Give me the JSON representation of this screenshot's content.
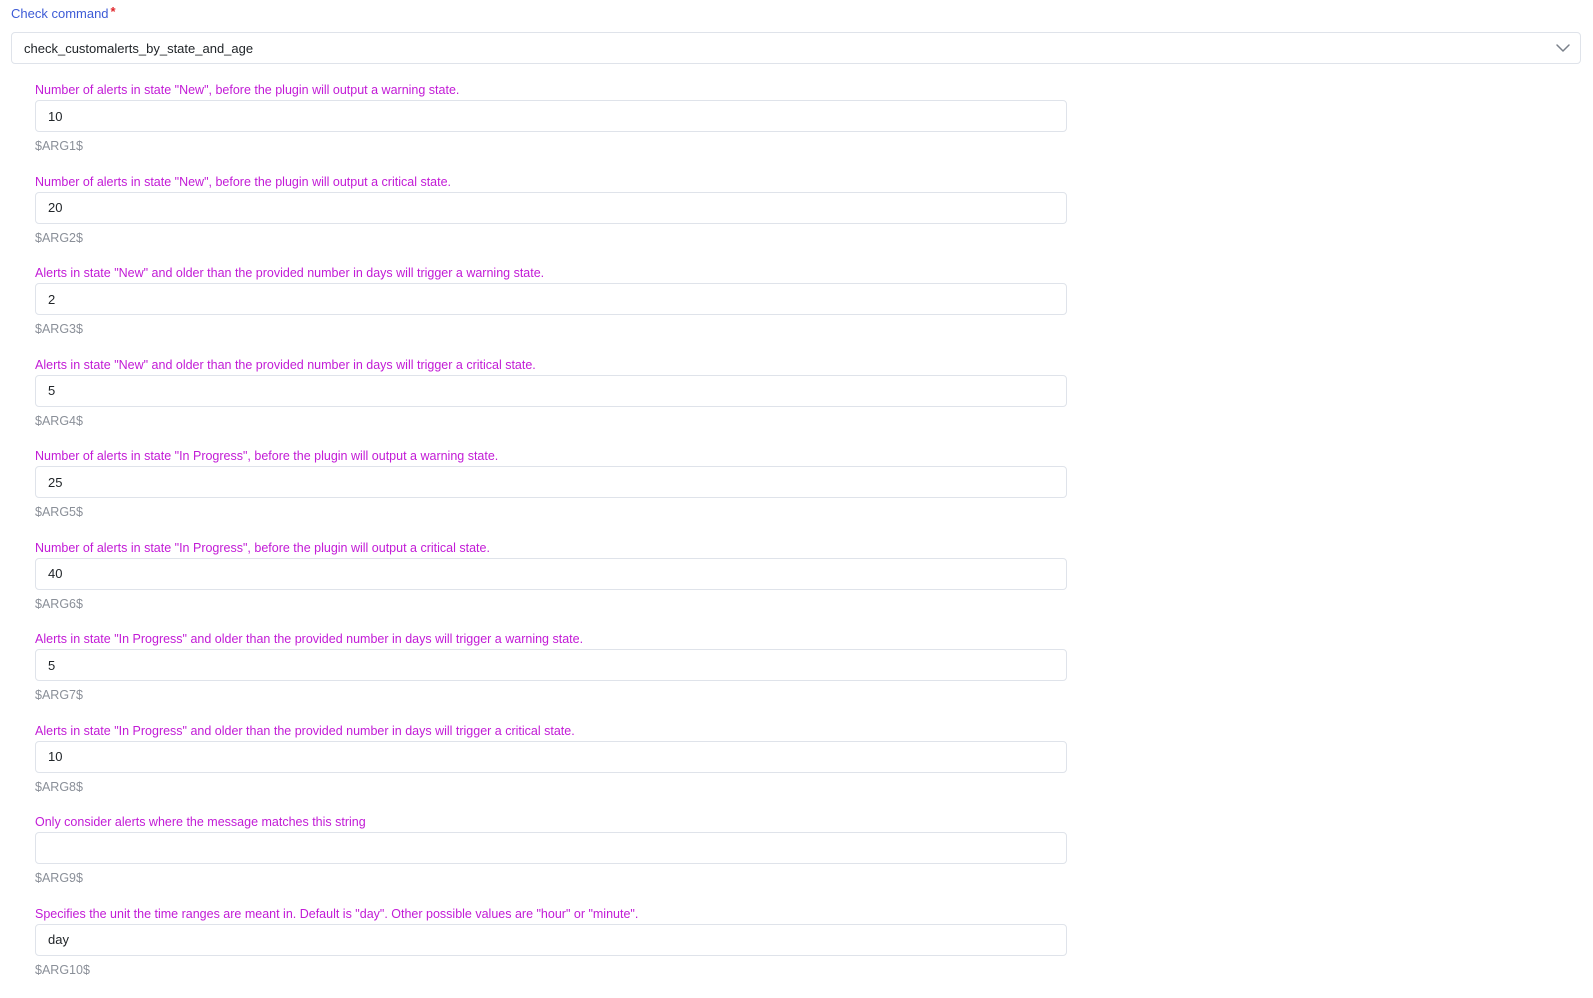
{
  "check_command": {
    "label": "Check command",
    "required_mark": "*",
    "value": "check_customalerts_by_state_and_age"
  },
  "icons": {
    "dropdown": "chevron-down-icon"
  },
  "colors": {
    "label_accent": "#3d5bd6",
    "required": "#e0262b",
    "arg_label": "#c21bd6",
    "hint": "#8a8f98"
  },
  "args": [
    {
      "label": "Number of alerts in state \"New\", before the plugin will output a warning state.",
      "value": "10",
      "hint": "$ARG1$"
    },
    {
      "label": "Number of alerts in state \"New\", before the plugin will output a critical state.",
      "value": "20",
      "hint": "$ARG2$"
    },
    {
      "label": "Alerts in state \"New\" and older than the provided number in days will trigger a warning state.",
      "value": "2",
      "hint": "$ARG3$"
    },
    {
      "label": "Alerts in state \"New\" and older than the provided number in days will trigger a critical state.",
      "value": "5",
      "hint": "$ARG4$"
    },
    {
      "label": "Number of alerts in state \"In Progress\", before the plugin will output a warning state.",
      "value": "25",
      "hint": "$ARG5$"
    },
    {
      "label": "Number of alerts in state \"In Progress\", before the plugin will output a critical state.",
      "value": "40",
      "hint": "$ARG6$"
    },
    {
      "label": "Alerts in state \"In Progress\" and older than the provided number in days will trigger a warning state.",
      "value": "5",
      "hint": "$ARG7$"
    },
    {
      "label": "Alerts in state \"In Progress\" and older than the provided number in days will trigger a critical state.",
      "value": "10",
      "hint": "$ARG8$"
    },
    {
      "label": "Only consider alerts where the message matches this string",
      "value": "",
      "hint": "$ARG9$"
    },
    {
      "label": "Specifies the unit the time ranges are meant in. Default is \"day\". Other possible values are \"hour\" or \"minute\".",
      "value": "day",
      "hint": "$ARG10$"
    }
  ]
}
